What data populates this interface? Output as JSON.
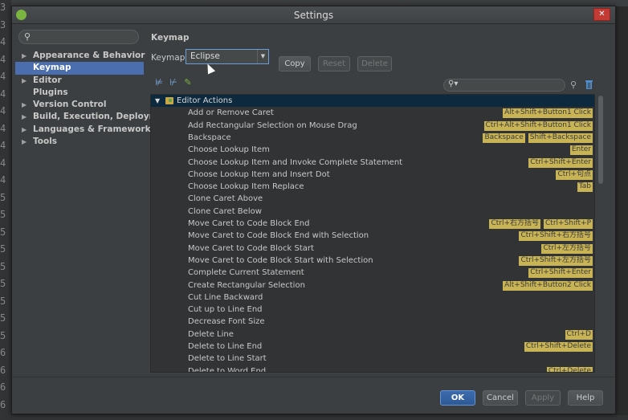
{
  "window": {
    "title": "Settings",
    "close_glyph": "✕"
  },
  "gutter_numbers": [
    "3",
    "3",
    "4",
    "4",
    "4",
    "4",
    "4",
    "4",
    "4",
    "4",
    "4",
    "5",
    "5",
    "5",
    "5",
    "5",
    "5",
    "5",
    "5",
    "5",
    "6",
    "6",
    "6",
    "6"
  ],
  "sidebar": {
    "search_placeholder": "",
    "items": [
      {
        "label": "Appearance & Behavior",
        "expandable": true,
        "selected": false
      },
      {
        "label": "Keymap",
        "expandable": false,
        "selected": true
      },
      {
        "label": "Editor",
        "expandable": true,
        "selected": false
      },
      {
        "label": "Plugins",
        "expandable": false,
        "selected": false
      },
      {
        "label": "Version Control",
        "expandable": true,
        "selected": false
      },
      {
        "label": "Build, Execution, Deployment",
        "expandable": true,
        "selected": false
      },
      {
        "label": "Languages & Frameworks",
        "expandable": true,
        "selected": false
      },
      {
        "label": "Tools",
        "expandable": true,
        "selected": false
      }
    ]
  },
  "keymap": {
    "section_title": "Keymap",
    "keymaps_label": "Keymaps:",
    "selected_keymap": "Eclipse",
    "copy_label": "Copy",
    "reset_label": "Reset",
    "delete_label": "Delete",
    "filter_placeholder": "",
    "group_label": "Editor Actions",
    "actions": [
      {
        "name": "Add or Remove Caret",
        "keys": [
          "Alt+Shift+Button1 Click"
        ]
      },
      {
        "name": "Add Rectangular Selection on Mouse Drag",
        "keys": [
          "Ctrl+Alt+Shift+Button1 Click"
        ]
      },
      {
        "name": "Backspace",
        "keys": [
          "Backspace",
          "Shift+Backspace"
        ]
      },
      {
        "name": "Choose Lookup Item",
        "keys": [
          "Enter"
        ]
      },
      {
        "name": "Choose Lookup Item and Invoke Complete Statement",
        "keys": [
          "Ctrl+Shift+Enter"
        ]
      },
      {
        "name": "Choose Lookup Item and Insert Dot",
        "keys": [
          "Ctrl+句点"
        ]
      },
      {
        "name": "Choose Lookup Item Replace",
        "keys": [
          "Tab"
        ]
      },
      {
        "name": "Clone Caret Above",
        "keys": []
      },
      {
        "name": "Clone Caret Below",
        "keys": []
      },
      {
        "name": "Move Caret to Code Block End",
        "keys": [
          "Ctrl+右方括号",
          "Ctrl+Shift+P"
        ]
      },
      {
        "name": "Move Caret to Code Block End with Selection",
        "keys": [
          "Ctrl+Shift+右方括号"
        ]
      },
      {
        "name": "Move Caret to Code Block Start",
        "keys": [
          "Ctrl+左方括号"
        ]
      },
      {
        "name": "Move Caret to Code Block Start with Selection",
        "keys": [
          "Ctrl+Shift+左方括号"
        ]
      },
      {
        "name": "Complete Current Statement",
        "keys": [
          "Ctrl+Shift+Enter"
        ]
      },
      {
        "name": "Create Rectangular Selection",
        "keys": [
          "Alt+Shift+Button2 Click"
        ]
      },
      {
        "name": "Cut Line Backward",
        "keys": []
      },
      {
        "name": "Cut up to Line End",
        "keys": []
      },
      {
        "name": "Decrease Font Size",
        "keys": []
      },
      {
        "name": "Delete Line",
        "keys": [
          "Ctrl+D"
        ]
      },
      {
        "name": "Delete to Line End",
        "keys": [
          "Ctrl+Shift+Delete"
        ]
      },
      {
        "name": "Delete to Line Start",
        "keys": []
      },
      {
        "name": "Delete to Word End",
        "keys": [
          "Ctrl+Delete"
        ]
      }
    ]
  },
  "footer": {
    "ok_label": "OK",
    "cancel_label": "Cancel",
    "apply_label": "Apply",
    "help_label": "Help"
  }
}
